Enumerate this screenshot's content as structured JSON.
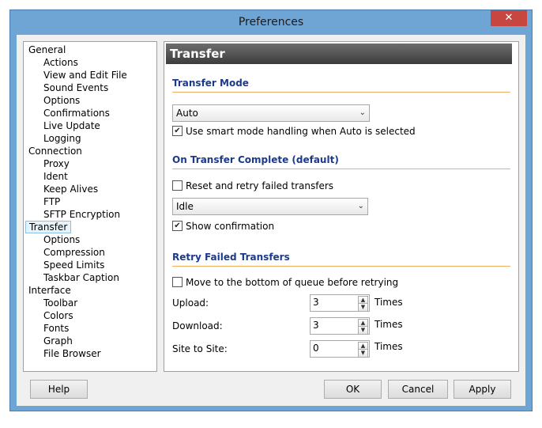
{
  "window": {
    "title": "Preferences",
    "close_label": "✕"
  },
  "tree": {
    "items": [
      {
        "label": "General",
        "level": 0
      },
      {
        "label": "Actions",
        "level": 1
      },
      {
        "label": "View and Edit File",
        "level": 1
      },
      {
        "label": "Sound Events",
        "level": 1
      },
      {
        "label": "Options",
        "level": 1
      },
      {
        "label": "Confirmations",
        "level": 1
      },
      {
        "label": "Live Update",
        "level": 1
      },
      {
        "label": "Logging",
        "level": 1
      },
      {
        "label": "Connection",
        "level": 0
      },
      {
        "label": "Proxy",
        "level": 1
      },
      {
        "label": "Ident",
        "level": 1
      },
      {
        "label": "Keep Alives",
        "level": 1
      },
      {
        "label": "FTP",
        "level": 1
      },
      {
        "label": "SFTP Encryption",
        "level": 1
      },
      {
        "label": "Transfer",
        "level": 0,
        "selected": true
      },
      {
        "label": "Options",
        "level": 1
      },
      {
        "label": "Compression",
        "level": 1
      },
      {
        "label": "Speed Limits",
        "level": 1
      },
      {
        "label": "Taskbar Caption",
        "level": 1
      },
      {
        "label": "Interface",
        "level": 0
      },
      {
        "label": "Toolbar",
        "level": 1
      },
      {
        "label": "Colors",
        "level": 1
      },
      {
        "label": "Fonts",
        "level": 1
      },
      {
        "label": "Graph",
        "level": 1
      },
      {
        "label": "File Browser",
        "level": 1
      }
    ]
  },
  "panel": {
    "header": "Transfer",
    "transfer_mode": {
      "title": "Transfer Mode",
      "select_value": "Auto",
      "smart_mode_label": "Use smart mode handling when Auto is selected",
      "smart_mode_checked": true
    },
    "on_complete": {
      "title": "On Transfer Complete (default)",
      "reset_label": "Reset and retry failed transfers",
      "reset_checked": false,
      "select_value": "Idle",
      "show_confirmation_label": "Show confirmation",
      "show_confirmation_checked": true
    },
    "retry": {
      "title": "Retry Failed Transfers",
      "move_label": "Move to the bottom of queue before retrying",
      "move_checked": false,
      "upload_label": "Upload:",
      "upload_value": "3",
      "download_label": "Download:",
      "download_value": "3",
      "site_label": "Site to Site:",
      "site_value": "0",
      "unit": "Times"
    }
  },
  "buttons": {
    "help": "Help",
    "ok": "OK",
    "cancel": "Cancel",
    "apply": "Apply"
  },
  "glyphs": {
    "check": "✔",
    "arrow_down": "⌄",
    "spin_up": "▲",
    "spin_down": "▼"
  },
  "colors": {
    "titlebar": "#6fa5d4",
    "close": "#c7463f",
    "section_title": "#1b3a8a",
    "section_line": "#f0b060"
  }
}
